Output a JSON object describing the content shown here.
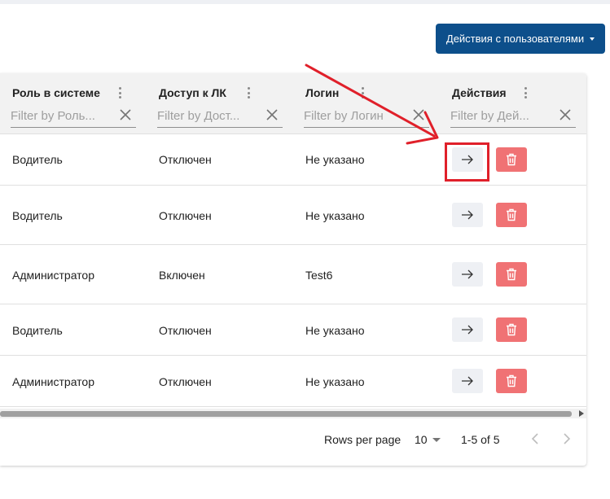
{
  "toolbar": {
    "user_actions_label": "Действия с пользователями"
  },
  "table": {
    "columns": [
      {
        "title": "Роль в системе",
        "filter_placeholder": "Filter by Роль..."
      },
      {
        "title": "Доступ к ЛК",
        "filter_placeholder": "Filter by Дост..."
      },
      {
        "title": "Логин",
        "filter_placeholder": "Filter by Логин"
      },
      {
        "title": "Действия",
        "filter_placeholder": "Filter by Дей..."
      }
    ],
    "rows": [
      {
        "role": "Водитель",
        "access": "Отключен",
        "login": "Не указано"
      },
      {
        "role": "Водитель",
        "access": "Отключен",
        "login": "Не указано"
      },
      {
        "role": "Администратор",
        "access": "Включен",
        "login": "Test6"
      },
      {
        "role": "Водитель",
        "access": "Отключен",
        "login": "Не указано"
      },
      {
        "role": "Администратор",
        "access": "Отключен",
        "login": "Не указано"
      }
    ]
  },
  "pagination": {
    "rows_per_page_label": "Rows per page",
    "rows_per_page_value": "10",
    "range_text": "1-5 of 5"
  },
  "icons": {
    "open": "arrow-right-icon",
    "delete": "trash-icon",
    "column_menu": "more-vertical-icon",
    "clear_filter": "close-icon",
    "prev": "chevron-left-icon",
    "next": "chevron-right-icon"
  },
  "colors": {
    "primary": "#0d4f8b",
    "delete": "#f07274",
    "annotation": "#e0202a"
  }
}
